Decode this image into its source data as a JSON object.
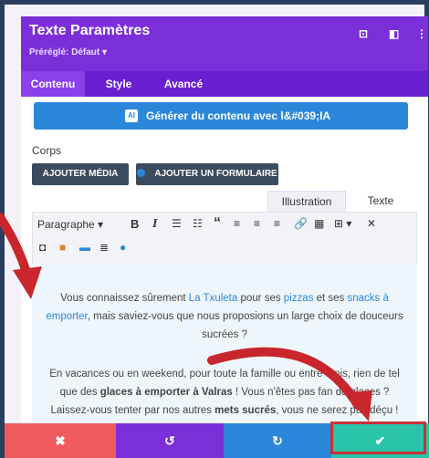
{
  "modal": {
    "title": "Texte Paramètres",
    "preset": "Préréglé: Défaut ▾",
    "icons": [
      "focus-icon",
      "split-view-icon",
      "more-vert-icon"
    ]
  },
  "tabs": [
    {
      "label": "Contenu",
      "active": true
    },
    {
      "label": "Style",
      "active": false
    },
    {
      "label": "Avancé",
      "active": false
    }
  ],
  "content": {
    "ai_badge": "AI",
    "ai_button_label": "Générer du contenu avec l&#039;IA",
    "section_label": "Corps",
    "add_media_label": "AJOUTER MÉDIA",
    "add_form_label": "AJOUTER UN FORMULAIRE"
  },
  "editor": {
    "tabs": [
      {
        "label": "Illustration",
        "active": true
      },
      {
        "label": "Texte",
        "active": false
      }
    ],
    "format_select": "Paragraphe",
    "toolbar_icons": [
      "bold-icon",
      "italic-icon",
      "bullet-list-icon",
      "numbered-list-icon",
      "blockquote-icon",
      "align-left-icon",
      "align-center-icon",
      "align-right-icon",
      "link-icon",
      "keyboard-icon",
      "table-icon",
      "fullscreen-icon",
      "toolbar-toggle-icon",
      "color-palette-icon",
      "strip-icon",
      "justify-icon",
      "user-icon"
    ],
    "paragraph1": {
      "t1": "Vous connaissez sûrement ",
      "link1": "La Txuleta",
      "t2": " pour ses ",
      "link2": "pizzas",
      "t3": " et ses ",
      "link3": "snacks à emporter",
      "t4": ", mais saviez-vous que nous proposions un large choix de douceurs sucrées ?"
    },
    "paragraph2": {
      "t1": "En vacances ou en weekend, pour toute la famille ou entre amis, rien de tel que des ",
      "b1": "glaces à emporter à Valras",
      "t2": " ! Vous n'êtes pas fan de glaces ? Laissez-vous tenter par nos autres ",
      "b2": "mets sucrés",
      "t3": ", vous ne serez pas déçu !"
    }
  },
  "footer": {
    "cancel_icon": "✖",
    "undo_icon": "↺",
    "redo_icon": "↻",
    "save_icon": "✔",
    "colors": {
      "cancel": "#ef5a5f",
      "undo": "#7b2fd9",
      "redo": "#2b87da",
      "save": "#29c4a9"
    }
  }
}
